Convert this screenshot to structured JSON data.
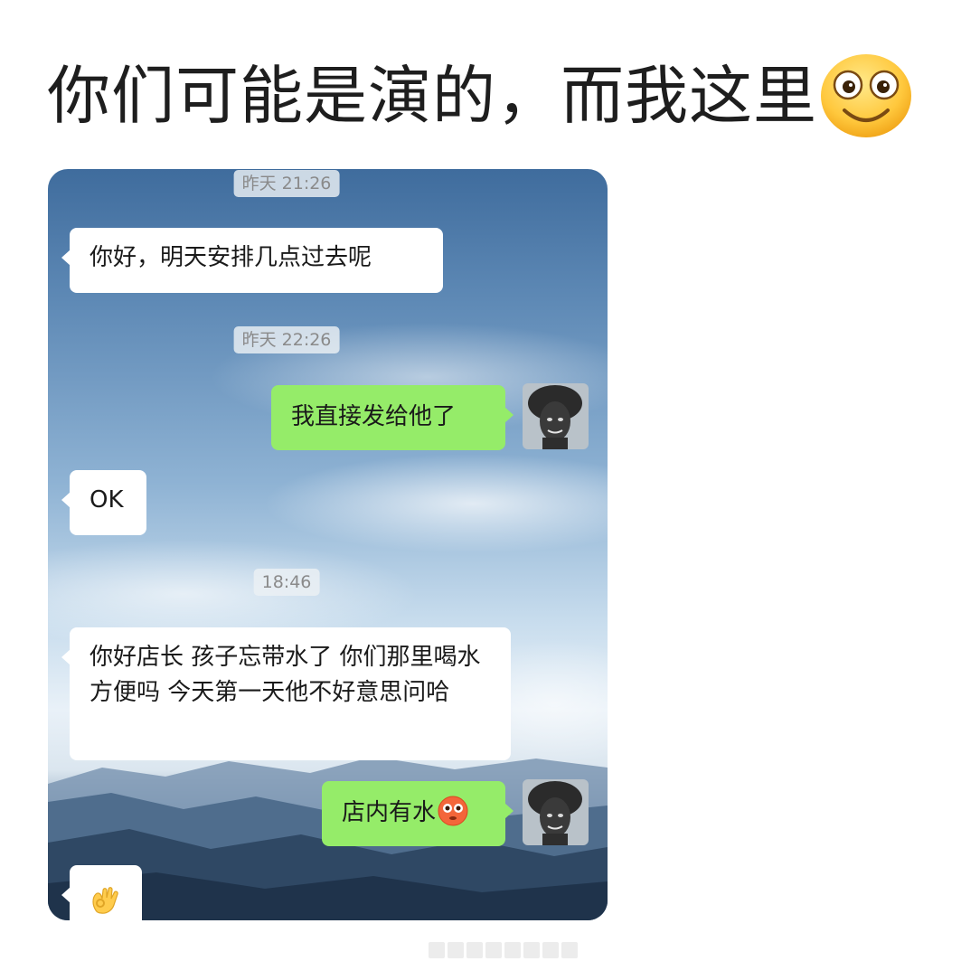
{
  "headline": {
    "text": "你们可能是演的，而我这里",
    "emoji_icon": "smiling-face-emoji-icon"
  },
  "chat": {
    "messages": [
      {
        "kind": "timestamp",
        "text": "昨天 21:26"
      },
      {
        "kind": "incoming",
        "text": "你好，明天安排几点过去呢"
      },
      {
        "kind": "timestamp",
        "text": "昨天 22:26"
      },
      {
        "kind": "outgoing",
        "text": "我直接发给他了"
      },
      {
        "kind": "incoming",
        "text": "OK"
      },
      {
        "kind": "timestamp",
        "text": "18:46"
      },
      {
        "kind": "incoming",
        "text": "你好店长  孩子忘带水了  你们那里喝水方便吗  今天第一天他不好意思问哈"
      },
      {
        "kind": "outgoing",
        "text": "店内有水",
        "emoji_icon": "flushed-face-emoji-icon"
      },
      {
        "kind": "incoming",
        "emoji_icon": "ok-hand-emoji-icon"
      }
    ],
    "colors": {
      "outgoing_bubble": "#95ec69",
      "incoming_bubble": "#ffffff"
    }
  }
}
